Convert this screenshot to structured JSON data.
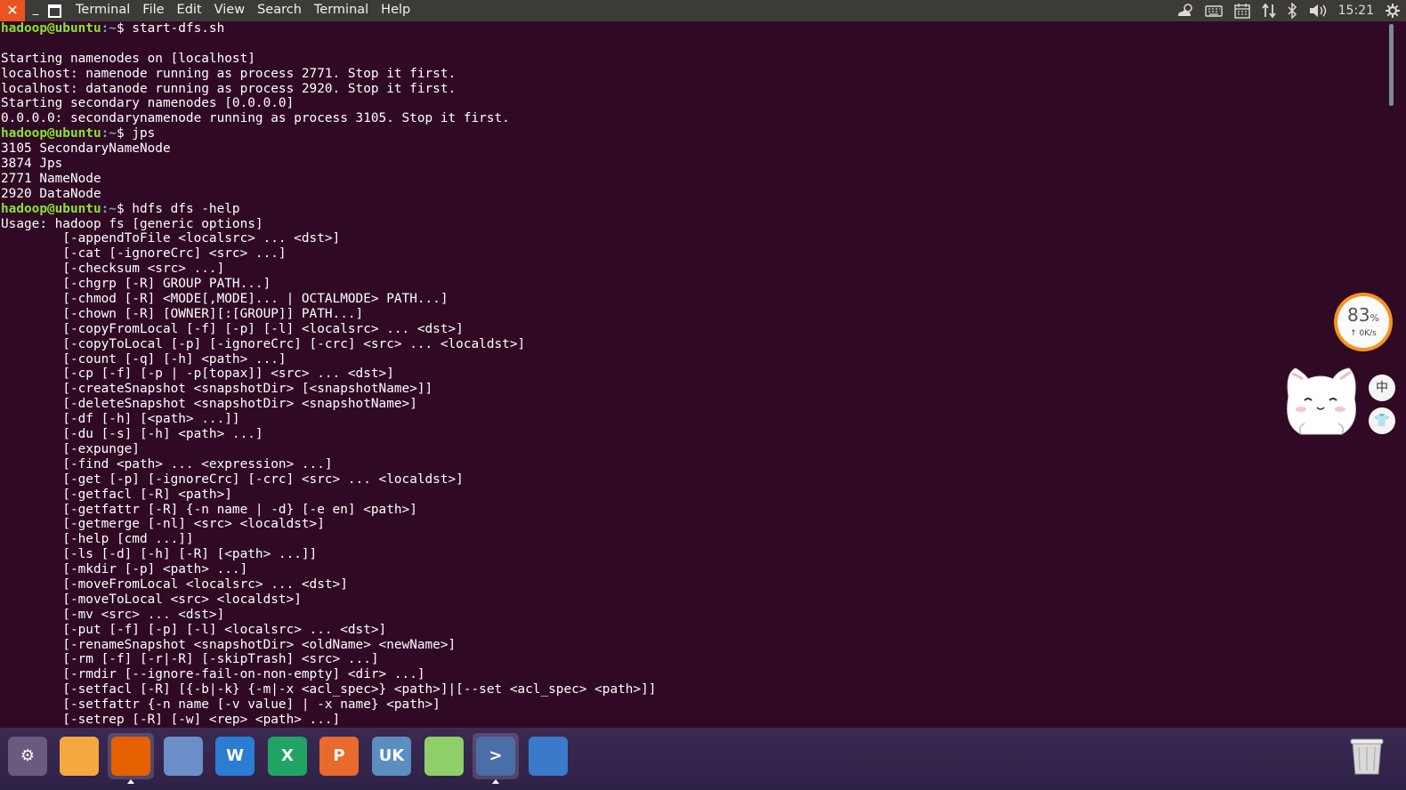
{
  "topbar": {
    "app_name": "Terminal",
    "menus": [
      "File",
      "Edit",
      "View",
      "Search",
      "Terminal",
      "Help"
    ],
    "clock": "15:21",
    "close_glyph": "✕",
    "minimize_glyph": "_"
  },
  "terminal": {
    "prompt_user": "hadoop@ubuntu",
    "prompt_path": ":~",
    "lines": [
      {
        "type": "prompt",
        "cmd": "$ start-dfs.sh"
      },
      {
        "type": "out",
        "text": ""
      },
      {
        "type": "out",
        "text": "Starting namenodes on [localhost]"
      },
      {
        "type": "out",
        "text": "localhost: namenode running as process 2771. Stop it first."
      },
      {
        "type": "out",
        "text": "localhost: datanode running as process 2920. Stop it first."
      },
      {
        "type": "out",
        "text": "Starting secondary namenodes [0.0.0.0]"
      },
      {
        "type": "out",
        "text": "0.0.0.0: secondarynamenode running as process 3105. Stop it first."
      },
      {
        "type": "prompt",
        "cmd": "$ jps"
      },
      {
        "type": "out",
        "text": "3105 SecondaryNameNode"
      },
      {
        "type": "out",
        "text": "3874 Jps"
      },
      {
        "type": "out",
        "text": "2771 NameNode"
      },
      {
        "type": "out",
        "text": "2920 DataNode"
      },
      {
        "type": "prompt",
        "cmd": "$ hdfs dfs -help"
      },
      {
        "type": "out",
        "text": "Usage: hadoop fs [generic options]"
      },
      {
        "type": "out",
        "text": "\t[-appendToFile <localsrc> ... <dst>]"
      },
      {
        "type": "out",
        "text": "\t[-cat [-ignoreCrc] <src> ...]"
      },
      {
        "type": "out",
        "text": "\t[-checksum <src> ...]"
      },
      {
        "type": "out",
        "text": "\t[-chgrp [-R] GROUP PATH...]"
      },
      {
        "type": "out",
        "text": "\t[-chmod [-R] <MODE[,MODE]... | OCTALMODE> PATH...]"
      },
      {
        "type": "out",
        "text": "\t[-chown [-R] [OWNER][:[GROUP]] PATH...]"
      },
      {
        "type": "out",
        "text": "\t[-copyFromLocal [-f] [-p] [-l] <localsrc> ... <dst>]"
      },
      {
        "type": "out",
        "text": "\t[-copyToLocal [-p] [-ignoreCrc] [-crc] <src> ... <localdst>]"
      },
      {
        "type": "out",
        "text": "\t[-count [-q] [-h] <path> ...]"
      },
      {
        "type": "out",
        "text": "\t[-cp [-f] [-p | -p[topax]] <src> ... <dst>]"
      },
      {
        "type": "out",
        "text": "\t[-createSnapshot <snapshotDir> [<snapshotName>]]"
      },
      {
        "type": "out",
        "text": "\t[-deleteSnapshot <snapshotDir> <snapshotName>]"
      },
      {
        "type": "out",
        "text": "\t[-df [-h] [<path> ...]]"
      },
      {
        "type": "out",
        "text": "\t[-du [-s] [-h] <path> ...]"
      },
      {
        "type": "out",
        "text": "\t[-expunge]"
      },
      {
        "type": "out",
        "text": "\t[-find <path> ... <expression> ...]"
      },
      {
        "type": "out",
        "text": "\t[-get [-p] [-ignoreCrc] [-crc] <src> ... <localdst>]"
      },
      {
        "type": "out",
        "text": "\t[-getfacl [-R] <path>]"
      },
      {
        "type": "out",
        "text": "\t[-getfattr [-R] {-n name | -d} [-e en] <path>]"
      },
      {
        "type": "out",
        "text": "\t[-getmerge [-nl] <src> <localdst>]"
      },
      {
        "type": "out",
        "text": "\t[-help [cmd ...]]"
      },
      {
        "type": "out",
        "text": "\t[-ls [-d] [-h] [-R] [<path> ...]]"
      },
      {
        "type": "out",
        "text": "\t[-mkdir [-p] <path> ...]"
      },
      {
        "type": "out",
        "text": "\t[-moveFromLocal <localsrc> ... <dst>]"
      },
      {
        "type": "out",
        "text": "\t[-moveToLocal <src> <localdst>]"
      },
      {
        "type": "out",
        "text": "\t[-mv <src> ... <dst>]"
      },
      {
        "type": "out",
        "text": "\t[-put [-f] [-p] [-l] <localsrc> ... <dst>]"
      },
      {
        "type": "out",
        "text": "\t[-renameSnapshot <snapshotDir> <oldName> <newName>]"
      },
      {
        "type": "out",
        "text": "\t[-rm [-f] [-r|-R] [-skipTrash] <src> ...]"
      },
      {
        "type": "out",
        "text": "\t[-rmdir [--ignore-fail-on-non-empty] <dir> ...]"
      },
      {
        "type": "out",
        "text": "\t[-setfacl [-R] [{-b|-k} {-m|-x <acl_spec>} <path>]|[--set <acl_spec> <path>]]"
      },
      {
        "type": "out",
        "text": "\t[-setfattr {-n name [-v value] | -x name} <path>]"
      },
      {
        "type": "out",
        "text": "\t[-setrep [-R] [-w] <rep> <path> ...]"
      }
    ]
  },
  "widgets": {
    "net_percent": "83",
    "net_percent_unit": "%",
    "net_speed": "↑ 0K/s",
    "side_button_1": "中",
    "side_button_2": "👕"
  },
  "dock": {
    "items": [
      {
        "name": "ubuntu-settings-icon",
        "glyph": "⚙",
        "color": "#6a5a80",
        "active": false
      },
      {
        "name": "files-icon",
        "glyph": "",
        "color": "#f5a742",
        "active": false
      },
      {
        "name": "firefox-icon",
        "glyph": "",
        "color": "#e66000",
        "active": true
      },
      {
        "name": "chromium-icon",
        "glyph": "",
        "color": "#6a8fc8",
        "active": false
      },
      {
        "name": "word-icon",
        "glyph": "W",
        "color": "#2b7cd3",
        "active": false
      },
      {
        "name": "excel-icon",
        "glyph": "X",
        "color": "#21a366",
        "active": false
      },
      {
        "name": "powerpoint-icon",
        "glyph": "P",
        "color": "#e86a2c",
        "active": false
      },
      {
        "name": "ukylin-icon",
        "glyph": "UK",
        "color": "#5a8dc0",
        "active": false
      },
      {
        "name": "screenshot-tool-icon",
        "glyph": "",
        "color": "#8fcf6a",
        "active": false
      },
      {
        "name": "terminal-icon",
        "glyph": ">",
        "color": "#4a6ea8",
        "active": true
      },
      {
        "name": "workspace-switcher-icon",
        "glyph": "",
        "color": "#3a7ac8",
        "active": false
      }
    ]
  },
  "colors": {
    "terminal_bg": "#300a24",
    "prompt_user": "#8ae234",
    "prompt_path": "#729fcf",
    "accent": "#e95420"
  }
}
